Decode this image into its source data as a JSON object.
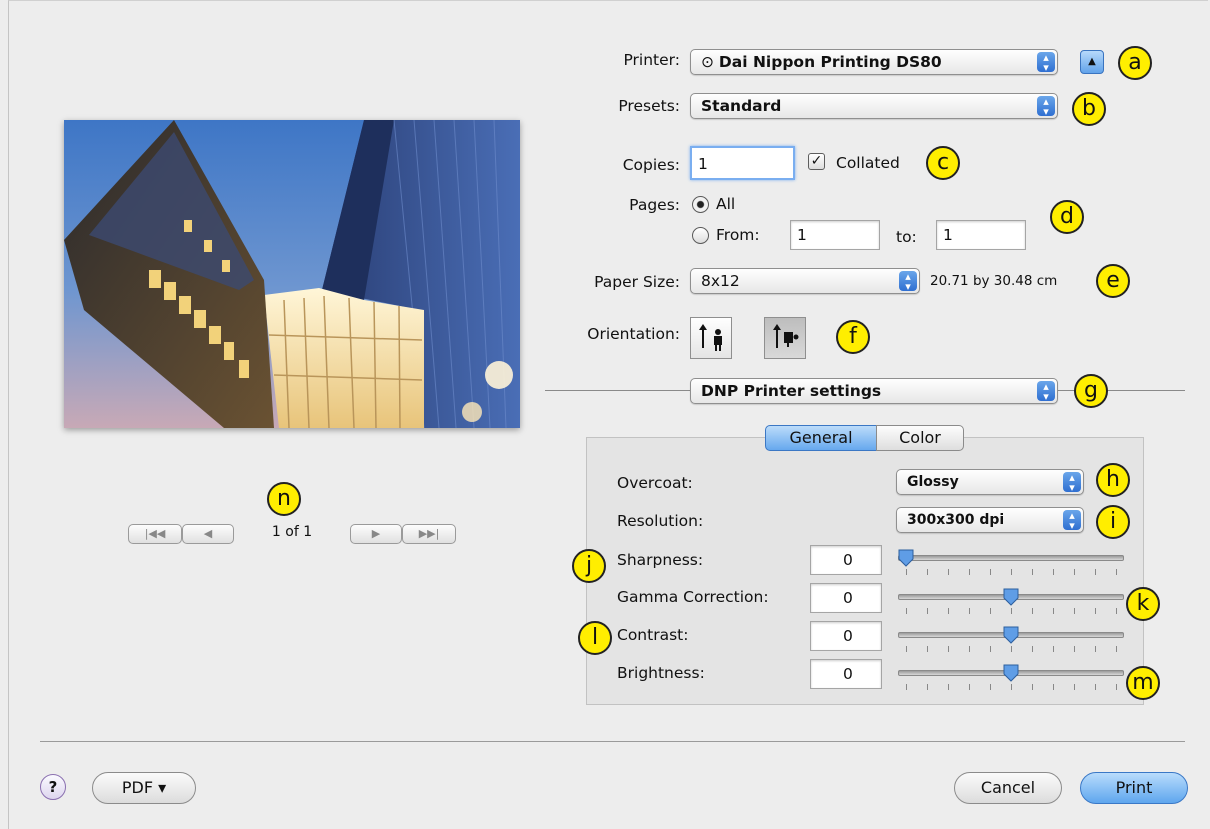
{
  "printer": {
    "label": "Printer:",
    "value": "Dai Nippon Printing DS80"
  },
  "presets": {
    "label": "Presets:",
    "value": "Standard"
  },
  "copies": {
    "label": "Copies:",
    "value": "1",
    "collated_label": "Collated",
    "collated": true
  },
  "pages": {
    "label": "Pages:",
    "all_label": "All",
    "from_label": "From:",
    "from_value": "1",
    "to_label": "to:",
    "to_value": "1",
    "selected": "All"
  },
  "paper_size": {
    "label": "Paper Size:",
    "value": "8x12",
    "dimensions": "20.71 by 30.48 cm"
  },
  "orientation": {
    "label": "Orientation:",
    "selected": "landscape"
  },
  "section_popup": {
    "value": "DNP Printer settings"
  },
  "tabs": [
    {
      "label": "General",
      "selected": true
    },
    {
      "label": "Color",
      "selected": false
    }
  ],
  "settings": {
    "overcoat": {
      "label": "Overcoat:",
      "value": "Glossy"
    },
    "resolution": {
      "label": "Resolution:",
      "value": "300x300 dpi"
    },
    "sharpness": {
      "label": "Sharpness:",
      "value": "0",
      "slider_fraction": 0.0
    },
    "gamma": {
      "label": "Gamma Correction:",
      "value": "0",
      "slider_fraction": 0.5
    },
    "contrast": {
      "label": "Contrast:",
      "value": "0",
      "slider_fraction": 0.5
    },
    "brightness": {
      "label": "Brightness:",
      "value": "0",
      "slider_fraction": 0.5
    }
  },
  "preview": {
    "page_indicator": "1 of 1"
  },
  "callouts": {
    "a": "a",
    "b": "b",
    "c": "c",
    "d": "d",
    "e": "e",
    "f": "f",
    "g": "g",
    "h": "h",
    "i": "i",
    "j": "j",
    "k": "k",
    "l": "l",
    "m": "m",
    "n": "n"
  },
  "footer": {
    "help": "?",
    "pdf_label": "PDF ▾",
    "cancel_label": "Cancel",
    "print_label": "Print"
  },
  "colors": {
    "accent": "#4a90e2",
    "callout": "#ffee00"
  }
}
